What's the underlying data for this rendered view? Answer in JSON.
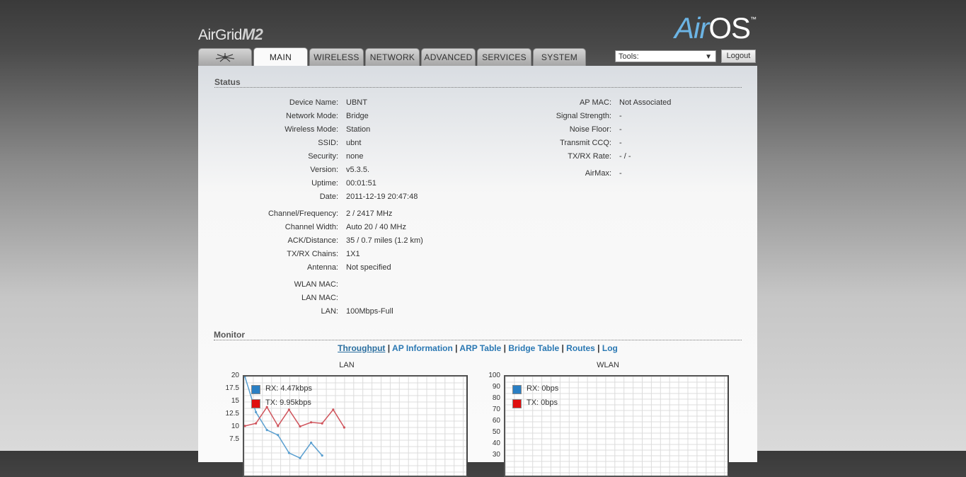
{
  "header": {
    "product_name": "AirGrid",
    "product_model": "M2",
    "os_prefix": "Air",
    "os_suffix": "OS",
    "os_trademark": "™"
  },
  "nav": {
    "tabs": [
      {
        "label": "",
        "icon": "ubiquiti-logo-icon"
      },
      {
        "label": "MAIN",
        "active": true
      },
      {
        "label": "WIRELESS"
      },
      {
        "label": "NETWORK"
      },
      {
        "label": "ADVANCED"
      },
      {
        "label": "SERVICES"
      },
      {
        "label": "SYSTEM"
      }
    ],
    "tools_label": "Tools:",
    "logout_label": "Logout"
  },
  "status": {
    "title": "Status",
    "left": [
      {
        "label": "Device Name:",
        "value": "UBNT"
      },
      {
        "label": "Network Mode:",
        "value": "Bridge"
      },
      {
        "label": "Wireless Mode:",
        "value": "Station"
      },
      {
        "label": "SSID:",
        "value": "ubnt"
      },
      {
        "label": "Security:",
        "value": "none"
      },
      {
        "label": "Version:",
        "value": "v5.3.5."
      },
      {
        "label": "Uptime:",
        "value": "00:01:51"
      },
      {
        "label": "Date:",
        "value": "2011-12-19 20:47:48"
      },
      {
        "label": "Channel/Frequency:",
        "value": "2 / 2417 MHz"
      },
      {
        "label": "Channel Width:",
        "value": "Auto 20 / 40 MHz"
      },
      {
        "label": "ACK/Distance:",
        "value": "35 / 0.7 miles (1.2 km)"
      },
      {
        "label": "TX/RX Chains:",
        "value": "1X1"
      },
      {
        "label": "Antenna:",
        "value": "Not specified"
      },
      {
        "label": "WLAN MAC:",
        "value": ""
      },
      {
        "label": "LAN MAC:",
        "value": ""
      },
      {
        "label": "LAN:",
        "value": "100Mbps-Full"
      }
    ],
    "right": [
      {
        "label": "AP MAC:",
        "value": "Not Associated"
      },
      {
        "label": "Signal Strength:",
        "value": "-"
      },
      {
        "label": "Noise Floor:",
        "value": "-"
      },
      {
        "label": "Transmit CCQ:",
        "value": "-"
      },
      {
        "label": "TX/RX Rate:",
        "value": "- / -"
      },
      {
        "label": "AirMax:",
        "value": "-"
      }
    ]
  },
  "monitor": {
    "title": "Monitor",
    "links": [
      "Throughput",
      "AP Information",
      "ARP Table",
      "Bridge Table",
      "Routes",
      "Log"
    ]
  },
  "chart_data": [
    {
      "type": "line",
      "title": "LAN",
      "yticks": [
        "20",
        "17.5",
        "15",
        "12.5",
        "10",
        "7.5"
      ],
      "ylim": [
        0,
        20
      ],
      "grid": true,
      "series": [
        {
          "name": "RX: 4.47kbps",
          "color": "#5a9fd0",
          "legend_color": "#2a7fc4",
          "values": [
            20,
            13,
            9.5,
            8.5,
            5,
            4,
            7,
            4.5
          ]
        },
        {
          "name": "TX: 9.95kbps",
          "color": "#d0545c",
          "legend_color": "#e01010",
          "values": [
            10.3,
            10.8,
            14,
            10.3,
            13.5,
            10.2,
            11,
            10.8,
            13.5,
            10
          ]
        }
      ]
    },
    {
      "type": "line",
      "title": "WLAN",
      "yticks": [
        "100",
        "90",
        "80",
        "70",
        "60",
        "50",
        "40",
        "30"
      ],
      "ylim": [
        0,
        100
      ],
      "grid": true,
      "series": [
        {
          "name": "RX: 0bps",
          "color": "#5a9fd0",
          "legend_color": "#2a7fc4",
          "values": []
        },
        {
          "name": "TX: 0bps",
          "color": "#d0545c",
          "legend_color": "#e01010",
          "values": []
        }
      ]
    }
  ]
}
